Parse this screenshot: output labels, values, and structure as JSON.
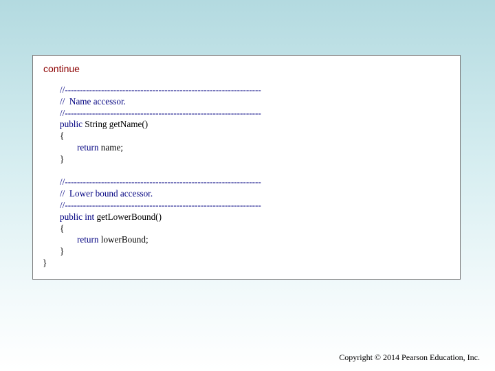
{
  "slide": {
    "continue_label": "continue",
    "copyright": "Copyright © 2014 Pearson Education, Inc."
  },
  "code_lines": [
    {
      "indent": 1,
      "tokens": [
        {
          "t": "//-----------------------------------------------------------------",
          "k": "comment"
        }
      ]
    },
    {
      "indent": 1,
      "tokens": [
        {
          "t": "//  Name accessor.",
          "k": "comment"
        }
      ]
    },
    {
      "indent": 1,
      "tokens": [
        {
          "t": "//-----------------------------------------------------------------",
          "k": "comment"
        }
      ]
    },
    {
      "indent": 1,
      "tokens": [
        {
          "t": "public ",
          "k": "keyword"
        },
        {
          "t": "String getName()",
          "k": "plain"
        }
      ]
    },
    {
      "indent": 1,
      "tokens": [
        {
          "t": "{",
          "k": "plain"
        }
      ]
    },
    {
      "indent": 2,
      "tokens": [
        {
          "t": "return ",
          "k": "keyword"
        },
        {
          "t": "name;",
          "k": "plain"
        }
      ]
    },
    {
      "indent": 1,
      "tokens": [
        {
          "t": "}",
          "k": "plain"
        }
      ]
    },
    {
      "indent": 0,
      "tokens": []
    },
    {
      "indent": 1,
      "tokens": [
        {
          "t": "//-----------------------------------------------------------------",
          "k": "comment"
        }
      ]
    },
    {
      "indent": 1,
      "tokens": [
        {
          "t": "//  Lower bound accessor.",
          "k": "comment"
        }
      ]
    },
    {
      "indent": 1,
      "tokens": [
        {
          "t": "//-----------------------------------------------------------------",
          "k": "comment"
        }
      ]
    },
    {
      "indent": 1,
      "tokens": [
        {
          "t": "public int ",
          "k": "keyword"
        },
        {
          "t": "getLowerBound()",
          "k": "plain"
        }
      ]
    },
    {
      "indent": 1,
      "tokens": [
        {
          "t": "{",
          "k": "plain"
        }
      ]
    },
    {
      "indent": 2,
      "tokens": [
        {
          "t": "return ",
          "k": "keyword"
        },
        {
          "t": "lowerBound;",
          "k": "plain"
        }
      ]
    },
    {
      "indent": 1,
      "tokens": [
        {
          "t": "}",
          "k": "plain"
        }
      ]
    },
    {
      "indent": 0,
      "tokens": [
        {
          "t": "}",
          "k": "plain"
        }
      ]
    }
  ]
}
